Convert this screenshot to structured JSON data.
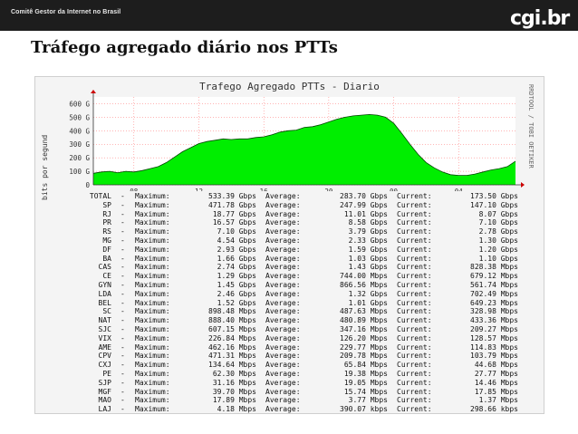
{
  "header": {
    "brand": "Comitê Gestor da Internet no Brasil",
    "logo_text": "cgi.br"
  },
  "slide_title": "Tráfego agregado diário nos PTTs",
  "chart_data": {
    "type": "area",
    "title": "Trafego Agregado PTTs - Diario",
    "ylabel": "bits por segund",
    "right_label": "RRDTOOL / TOBI OETIKER",
    "y_ticks": [
      "0",
      "100 G",
      "200 G",
      "300 G",
      "400 G",
      "500 G",
      "600 G"
    ],
    "ylim": [
      0,
      650
    ],
    "x_ticks": [
      "08",
      "12",
      "16",
      "20",
      "00",
      "04"
    ],
    "x_tick_hours": [
      8,
      12,
      16,
      20,
      24,
      28
    ],
    "xlim": [
      5.5,
      31.5
    ],
    "fill_color": "#00ee00",
    "line_color": "#004400",
    "grid_color": "#ff6a6a",
    "series": [
      {
        "x": [
          5.5,
          6.0,
          6.5,
          7.0,
          7.5,
          8.0,
          8.5,
          9.0,
          9.5,
          10.0,
          10.5,
          11.0,
          11.5,
          12.0,
          12.5,
          13.0,
          13.5,
          14.0,
          14.5,
          15.0,
          15.5,
          16.0,
          16.5,
          17.0,
          17.5,
          18.0,
          18.5,
          19.0,
          19.5,
          20.0,
          20.5,
          21.0,
          21.5,
          22.0,
          22.5,
          23.0,
          23.5,
          24.0,
          24.5,
          25.0,
          25.5,
          26.0,
          26.5,
          27.0,
          27.5,
          28.0,
          28.5,
          29.0,
          29.5,
          30.0,
          30.5,
          31.0,
          31.5
        ],
        "values": [
          85,
          95,
          100,
          90,
          100,
          95,
          105,
          120,
          135,
          165,
          205,
          245,
          275,
          305,
          320,
          330,
          340,
          335,
          340,
          340,
          350,
          355,
          370,
          390,
          400,
          405,
          425,
          430,
          445,
          465,
          485,
          500,
          510,
          515,
          520,
          515,
          500,
          455,
          380,
          300,
          225,
          165,
          125,
          95,
          75,
          70,
          70,
          80,
          95,
          110,
          120,
          135,
          175
        ]
      }
    ]
  },
  "stats": {
    "labels": {
      "maximum": "Maximum:",
      "average": "Average:",
      "current": "Current:"
    },
    "rows": [
      {
        "name": "TOTAL",
        "max": "533.39 Gbps",
        "avg": "283.70 Gbps",
        "cur": "173.50 Gbps"
      },
      {
        "name": "SP",
        "max": "471.78 Gbps",
        "avg": "247.99 Gbps",
        "cur": "147.10 Gbps"
      },
      {
        "name": "RJ",
        "max": "18.77 Gbps",
        "avg": "11.01 Gbps",
        "cur": "8.07 Gbps"
      },
      {
        "name": "PR",
        "max": "16.57 Gbps",
        "avg": "8.58 Gbps",
        "cur": "7.10 Gbps"
      },
      {
        "name": "RS",
        "max": "7.10 Gbps",
        "avg": "3.79 Gbps",
        "cur": "2.78 Gbps"
      },
      {
        "name": "MG",
        "max": "4.54 Gbps",
        "avg": "2.33 Gbps",
        "cur": "1.30 Gbps"
      },
      {
        "name": "DF",
        "max": "2.93 Gbps",
        "avg": "1.59 Gbps",
        "cur": "1.20 Gbps"
      },
      {
        "name": "BA",
        "max": "1.66 Gbps",
        "avg": "1.03 Gbps",
        "cur": "1.10 Gbps"
      },
      {
        "name": "CAS",
        "max": "2.74 Gbps",
        "avg": "1.43 Gbps",
        "cur": "828.38 Mbps"
      },
      {
        "name": "CE",
        "max": "1.29 Gbps",
        "avg": "744.00 Mbps",
        "cur": "679.12 Mbps"
      },
      {
        "name": "GYN",
        "max": "1.45 Gbps",
        "avg": "866.56 Mbps",
        "cur": "561.74 Mbps"
      },
      {
        "name": "LDA",
        "max": "2.46 Gbps",
        "avg": "1.32 Gbps",
        "cur": "702.49 Mbps"
      },
      {
        "name": "BEL",
        "max": "1.52 Gbps",
        "avg": "1.01 Gbps",
        "cur": "649.23 Mbps"
      },
      {
        "name": "SC",
        "max": "898.48 Mbps",
        "avg": "487.63 Mbps",
        "cur": "328.98 Mbps"
      },
      {
        "name": "NAT",
        "max": "888.40 Mbps",
        "avg": "480.89 Mbps",
        "cur": "433.36 Mbps"
      },
      {
        "name": "SJC",
        "max": "607.15 Mbps",
        "avg": "347.16 Mbps",
        "cur": "209.27 Mbps"
      },
      {
        "name": "VIX",
        "max": "226.84 Mbps",
        "avg": "126.20 Mbps",
        "cur": "128.57 Mbps"
      },
      {
        "name": "AME",
        "max": "462.16 Mbps",
        "avg": "229.77 Mbps",
        "cur": "114.83 Mbps"
      },
      {
        "name": "CPV",
        "max": "471.31 Mbps",
        "avg": "209.78 Mbps",
        "cur": "103.79 Mbps"
      },
      {
        "name": "CXJ",
        "max": "134.64 Mbps",
        "avg": "65.84 Mbps",
        "cur": "44.68 Mbps"
      },
      {
        "name": "PE",
        "max": "62.30 Mbps",
        "avg": "19.38 Mbps",
        "cur": "27.77 Mbps"
      },
      {
        "name": "SJP",
        "max": "31.16 Mbps",
        "avg": "19.05 Mbps",
        "cur": "14.46 Mbps"
      },
      {
        "name": "MGF",
        "max": "39.70 Mbps",
        "avg": "15.74 Mbps",
        "cur": "17.85 Mbps"
      },
      {
        "name": "MAO",
        "max": "17.89 Mbps",
        "avg": "3.77 Mbps",
        "cur": "1.37 Mbps"
      },
      {
        "name": "LAJ",
        "max": "4.18 Mbps",
        "avg": "390.07 kbps",
        "cur": "298.66 kbps"
      }
    ]
  }
}
